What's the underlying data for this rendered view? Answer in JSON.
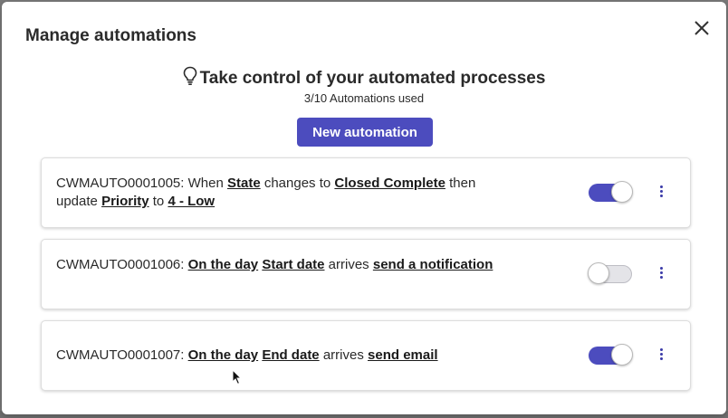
{
  "modal": {
    "title": "Manage automations",
    "close_icon": "close-icon"
  },
  "header": {
    "headline": "Take control of your automated processes",
    "headline_icon": "lightbulb-icon",
    "usage": "3/10 Automations used",
    "new_button_label": "New automation"
  },
  "colors": {
    "accent": "#4c4cbe",
    "toggle_off": "#e4e4e8"
  },
  "automations": [
    {
      "id": "CWMAUTO0001005:",
      "w1": "When",
      "field": "State",
      "w2": "changes to",
      "value": "Closed Complete",
      "w3": "then",
      "w4": "update",
      "target_field": "Priority",
      "w5": "to",
      "target_value": "4 - Low",
      "enabled": true
    },
    {
      "id": "CWMAUTO0001006:",
      "timing": "On the day",
      "field": "Start date",
      "w1": "arrives",
      "action": "send a notification",
      "enabled": false
    },
    {
      "id": "CWMAUTO0001007:",
      "timing": "On the day",
      "field": "End date",
      "w1": "arrives",
      "action": "send email",
      "enabled": true
    }
  ]
}
